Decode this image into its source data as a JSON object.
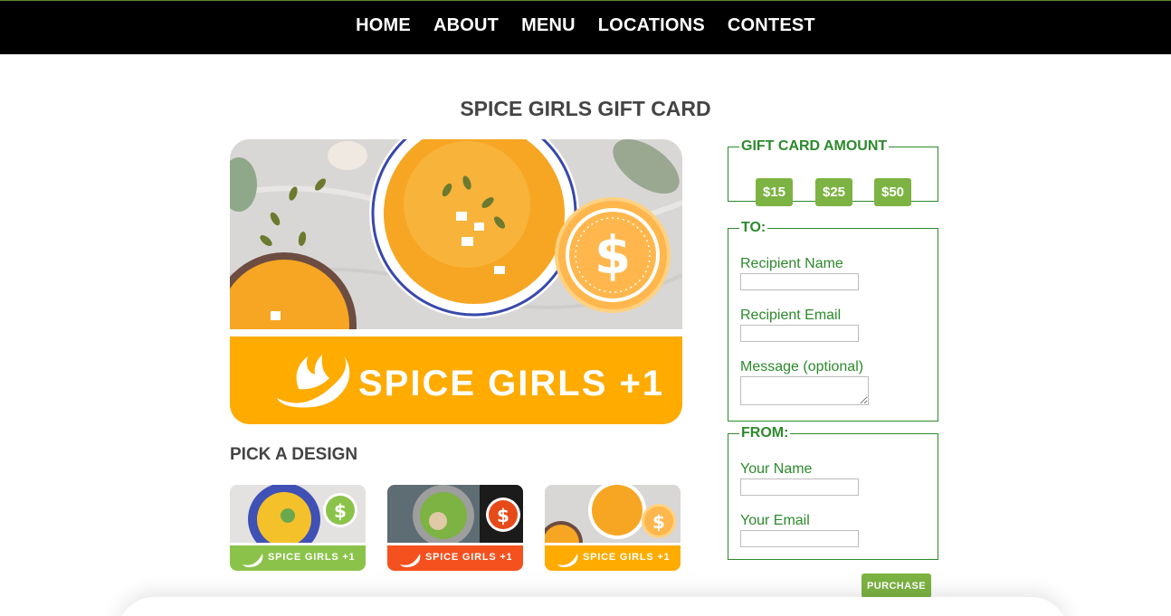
{
  "nav": {
    "items": [
      {
        "label": "HOME"
      },
      {
        "label": "ABOUT"
      },
      {
        "label": "MENU"
      },
      {
        "label": "LOCATIONS"
      },
      {
        "label": "CONTEST"
      }
    ]
  },
  "page": {
    "title": "SPICE GIRLS GIFT CARD",
    "pick_design_title": "PICK A DESIGN"
  },
  "card": {
    "brand_text": "SPICE GIRLS +1",
    "currency_symbol": "$"
  },
  "designs": [
    {
      "label": "SPICE GIRLS +1",
      "banner_color": "#8bc34a"
    },
    {
      "label": "SPICE GIRLS +1",
      "banner_color": "#f4511e"
    },
    {
      "label": "SPICE GIRLS +1",
      "banner_color": "#ffab00"
    }
  ],
  "amount": {
    "legend": "GIFT CARD AMOUNT",
    "options": [
      "$15",
      "$25",
      "$50"
    ]
  },
  "to": {
    "legend": "TO:",
    "recipient_name_label": "Recipient Name",
    "recipient_email_label": "Recipient Email",
    "message_label": "Message (optional)"
  },
  "from": {
    "legend": "FROM:",
    "your_name_label": "Your Name",
    "your_email_label": "Your Email"
  },
  "purchase_label": "PURCHASE",
  "colors": {
    "accent_green": "#7cb342",
    "form_green": "#2c8a2c",
    "card_orange": "#ffab00",
    "nav_bg": "#000000"
  }
}
